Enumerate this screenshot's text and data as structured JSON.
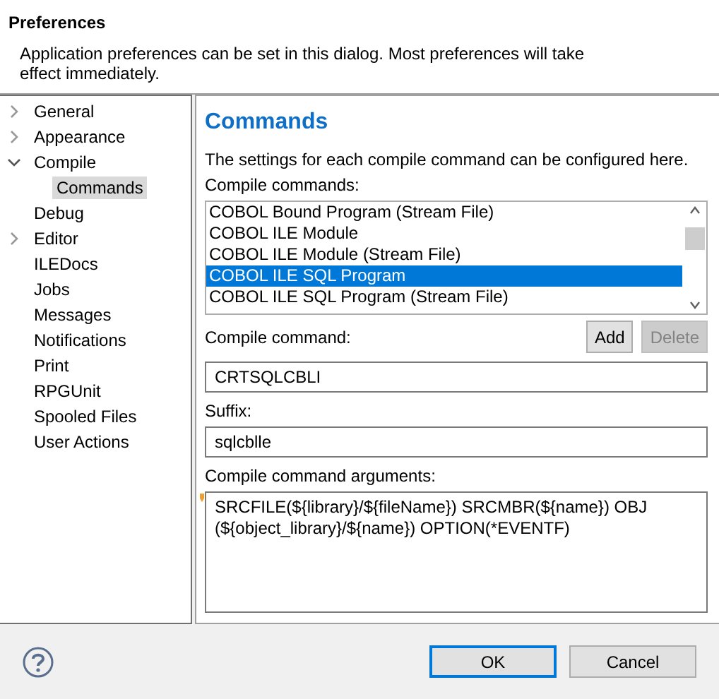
{
  "header": {
    "title": "Preferences",
    "description": "Application preferences can be set in this dialog. Most preferences will take effect immediately."
  },
  "tree": {
    "items": [
      {
        "label": "General",
        "kind": "group",
        "expanded": false,
        "selected": false
      },
      {
        "label": "Appearance",
        "kind": "group",
        "expanded": false,
        "selected": false
      },
      {
        "label": "Compile",
        "kind": "group",
        "expanded": true,
        "selected": false,
        "children": [
          {
            "label": "Commands",
            "kind": "leaf",
            "selected": true
          }
        ]
      },
      {
        "label": "Debug",
        "kind": "leaf",
        "selected": false
      },
      {
        "label": "Editor",
        "kind": "group",
        "expanded": false,
        "selected": false
      },
      {
        "label": "ILEDocs",
        "kind": "leaf",
        "selected": false
      },
      {
        "label": "Jobs",
        "kind": "leaf",
        "selected": false
      },
      {
        "label": "Messages",
        "kind": "leaf",
        "selected": false
      },
      {
        "label": "Notifications",
        "kind": "leaf",
        "selected": false
      },
      {
        "label": "Print",
        "kind": "leaf",
        "selected": false
      },
      {
        "label": "RPGUnit",
        "kind": "leaf",
        "selected": false
      },
      {
        "label": "Spooled Files",
        "kind": "leaf",
        "selected": false
      },
      {
        "label": "User Actions",
        "kind": "leaf",
        "selected": false
      }
    ]
  },
  "page": {
    "heading": "Commands",
    "intro": "The settings for each compile command can be configured here.",
    "commands_label": "Compile commands:",
    "commands": [
      {
        "label": "COBOL Bound Program (Stream File)",
        "selected": false
      },
      {
        "label": "COBOL ILE Module",
        "selected": false
      },
      {
        "label": "COBOL ILE Module (Stream File)",
        "selected": false
      },
      {
        "label": "COBOL ILE SQL Program",
        "selected": true
      },
      {
        "label": "COBOL ILE SQL Program (Stream File)",
        "selected": false
      }
    ],
    "command_label": "Compile command:",
    "buttons": [
      {
        "label": "Add",
        "disabled": false
      },
      {
        "label": "Delete",
        "disabled": true
      }
    ],
    "command_value": "CRTSQLCBLI",
    "suffix_label": "Suffix:",
    "suffix_value": "sqlcblle",
    "arguments_label": "Compile command arguments:",
    "arguments_value": "SRCFILE(${library}/${fileName}) SRCMBR(${name}) OBJ (${object_library}/${name}) OPTION(*EVENTF)"
  },
  "footer": {
    "buttons": [
      {
        "label": "OK",
        "default": true
      },
      {
        "label": "Cancel",
        "default": false
      }
    ]
  }
}
